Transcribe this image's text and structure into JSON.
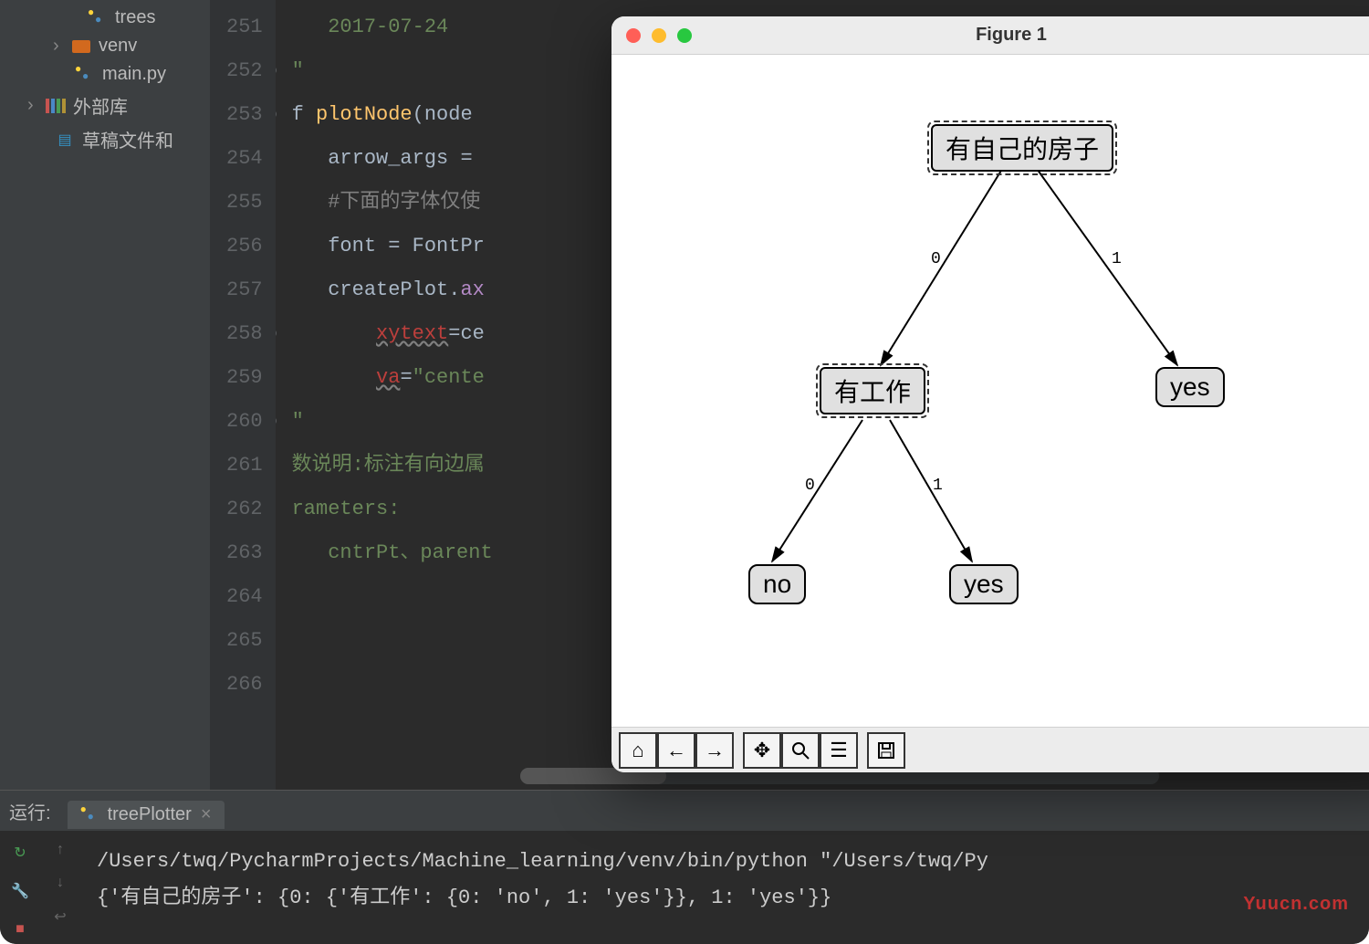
{
  "sidebar": {
    "items": [
      {
        "label": "trees",
        "type": "py",
        "indent": "deep"
      },
      {
        "label": "venv",
        "type": "folder",
        "indent": "mid",
        "chev": "›"
      },
      {
        "label": "main.py",
        "type": "py",
        "indent": "mid"
      },
      {
        "label": "外部库",
        "type": "lib",
        "indent": "root",
        "chev": "›"
      },
      {
        "label": "草稿文件和",
        "type": "scratch",
        "indent": "mid"
      }
    ]
  },
  "editor": {
    "first_line": 251,
    "lines": [
      {
        "html": "   <span class='c-str'>2017-07-24</span>"
      },
      {
        "html": "<span class='c-str'>\"</span>",
        "fold": "⊖"
      },
      {
        "html": "f <span class='c-fn'>plotNode</span>(node",
        "fold": "⊖"
      },
      {
        "html": "   arrow_args = "
      },
      {
        "html": "   <span class='c-cmt'>#下面的字体仅使</span>"
      },
      {
        "html": "   font = FontPr"
      },
      {
        "html": "   createPlot.<span class='c-prm'>ax</span>"
      },
      {
        "html": "       <span class='c-err'>xytext</span>=ce",
        "fold": "⊖"
      },
      {
        "html": "       <span class='c-err'>va</span>=<span class='c-str'>\"cente</span>"
      },
      {
        "html": ""
      },
      {
        "html": "<span class='c-str'>\"</span>",
        "fold": "⊖"
      },
      {
        "html": "<span class='c-str'>数说明:标注有向边属</span>"
      },
      {
        "html": ""
      },
      {
        "html": "<span class='c-str'>rameters:</span>"
      },
      {
        "html": "   <span class='c-str'>cntrPt、parent</span>"
      },
      {
        "html": ""
      }
    ]
  },
  "run": {
    "label": "运行:",
    "tab": "treePlotter",
    "lines": [
      "/Users/twq/PycharmProjects/Machine_learning/venv/bin/python \"/Users/twq/Py",
      "{'有自己的房子': {0: {'有工作': {0: 'no', 1: 'yes'}}, 1: 'yes'}}"
    ]
  },
  "figure": {
    "title": "Figure 1",
    "nodes": {
      "root": "有自己的房子",
      "left": "有工作",
      "right_leaf": "yes",
      "leaf_no": "no",
      "leaf_yes": "yes"
    },
    "edge_labels": {
      "e0": "0",
      "e1": "1",
      "e2": "0",
      "e3": "1"
    },
    "toolbar": [
      "home",
      "back",
      "forward",
      "pan",
      "zoom",
      "configure",
      "save"
    ]
  },
  "watermark": "Yuucn.com"
}
